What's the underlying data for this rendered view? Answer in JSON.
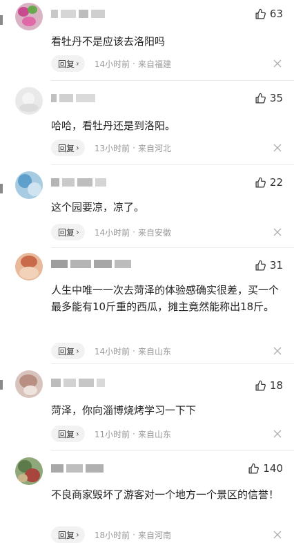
{
  "comments": [
    {
      "likes": "63",
      "text": "看牡丹不是应该去洛阳吗",
      "reply_label": "回复",
      "time": "14小时前",
      "location": "来自福建"
    },
    {
      "likes": "35",
      "text": "哈哈，看牡丹还是到洛阳。",
      "reply_label": "回复",
      "time": "13小时前",
      "location": "来自河北"
    },
    {
      "likes": "22",
      "text": "这个园要凉，凉了。",
      "reply_label": "回复",
      "time": "14小时前",
      "location": "来自安徽"
    },
    {
      "likes": "31",
      "text": "人生中唯一一次去菏泽的体验感确实很差，买一个最多能有10斤重的西瓜，摊主竟然能称出18斤。",
      "reply_label": "回复",
      "time": "14小时前",
      "location": "来自山东"
    },
    {
      "likes": "18",
      "text": "菏泽，你向淄博烧烤学习一下下",
      "reply_label": "回复",
      "time": "11小时前",
      "location": "来自山东"
    },
    {
      "likes": "140",
      "text": "不良商家毁坏了游客对一个地方一个景区的信誉！",
      "reply_label": "回复",
      "time": "18小时前",
      "location": "来自河南"
    }
  ],
  "colors": {
    "reply_bg": "#f2f2f2",
    "meta_gray": "#9a9a9a",
    "text": "#222222"
  },
  "icons": {
    "like": "thumbs-up-icon",
    "reply_arrow": "chevron-right-icon",
    "dismiss": "close-icon"
  }
}
